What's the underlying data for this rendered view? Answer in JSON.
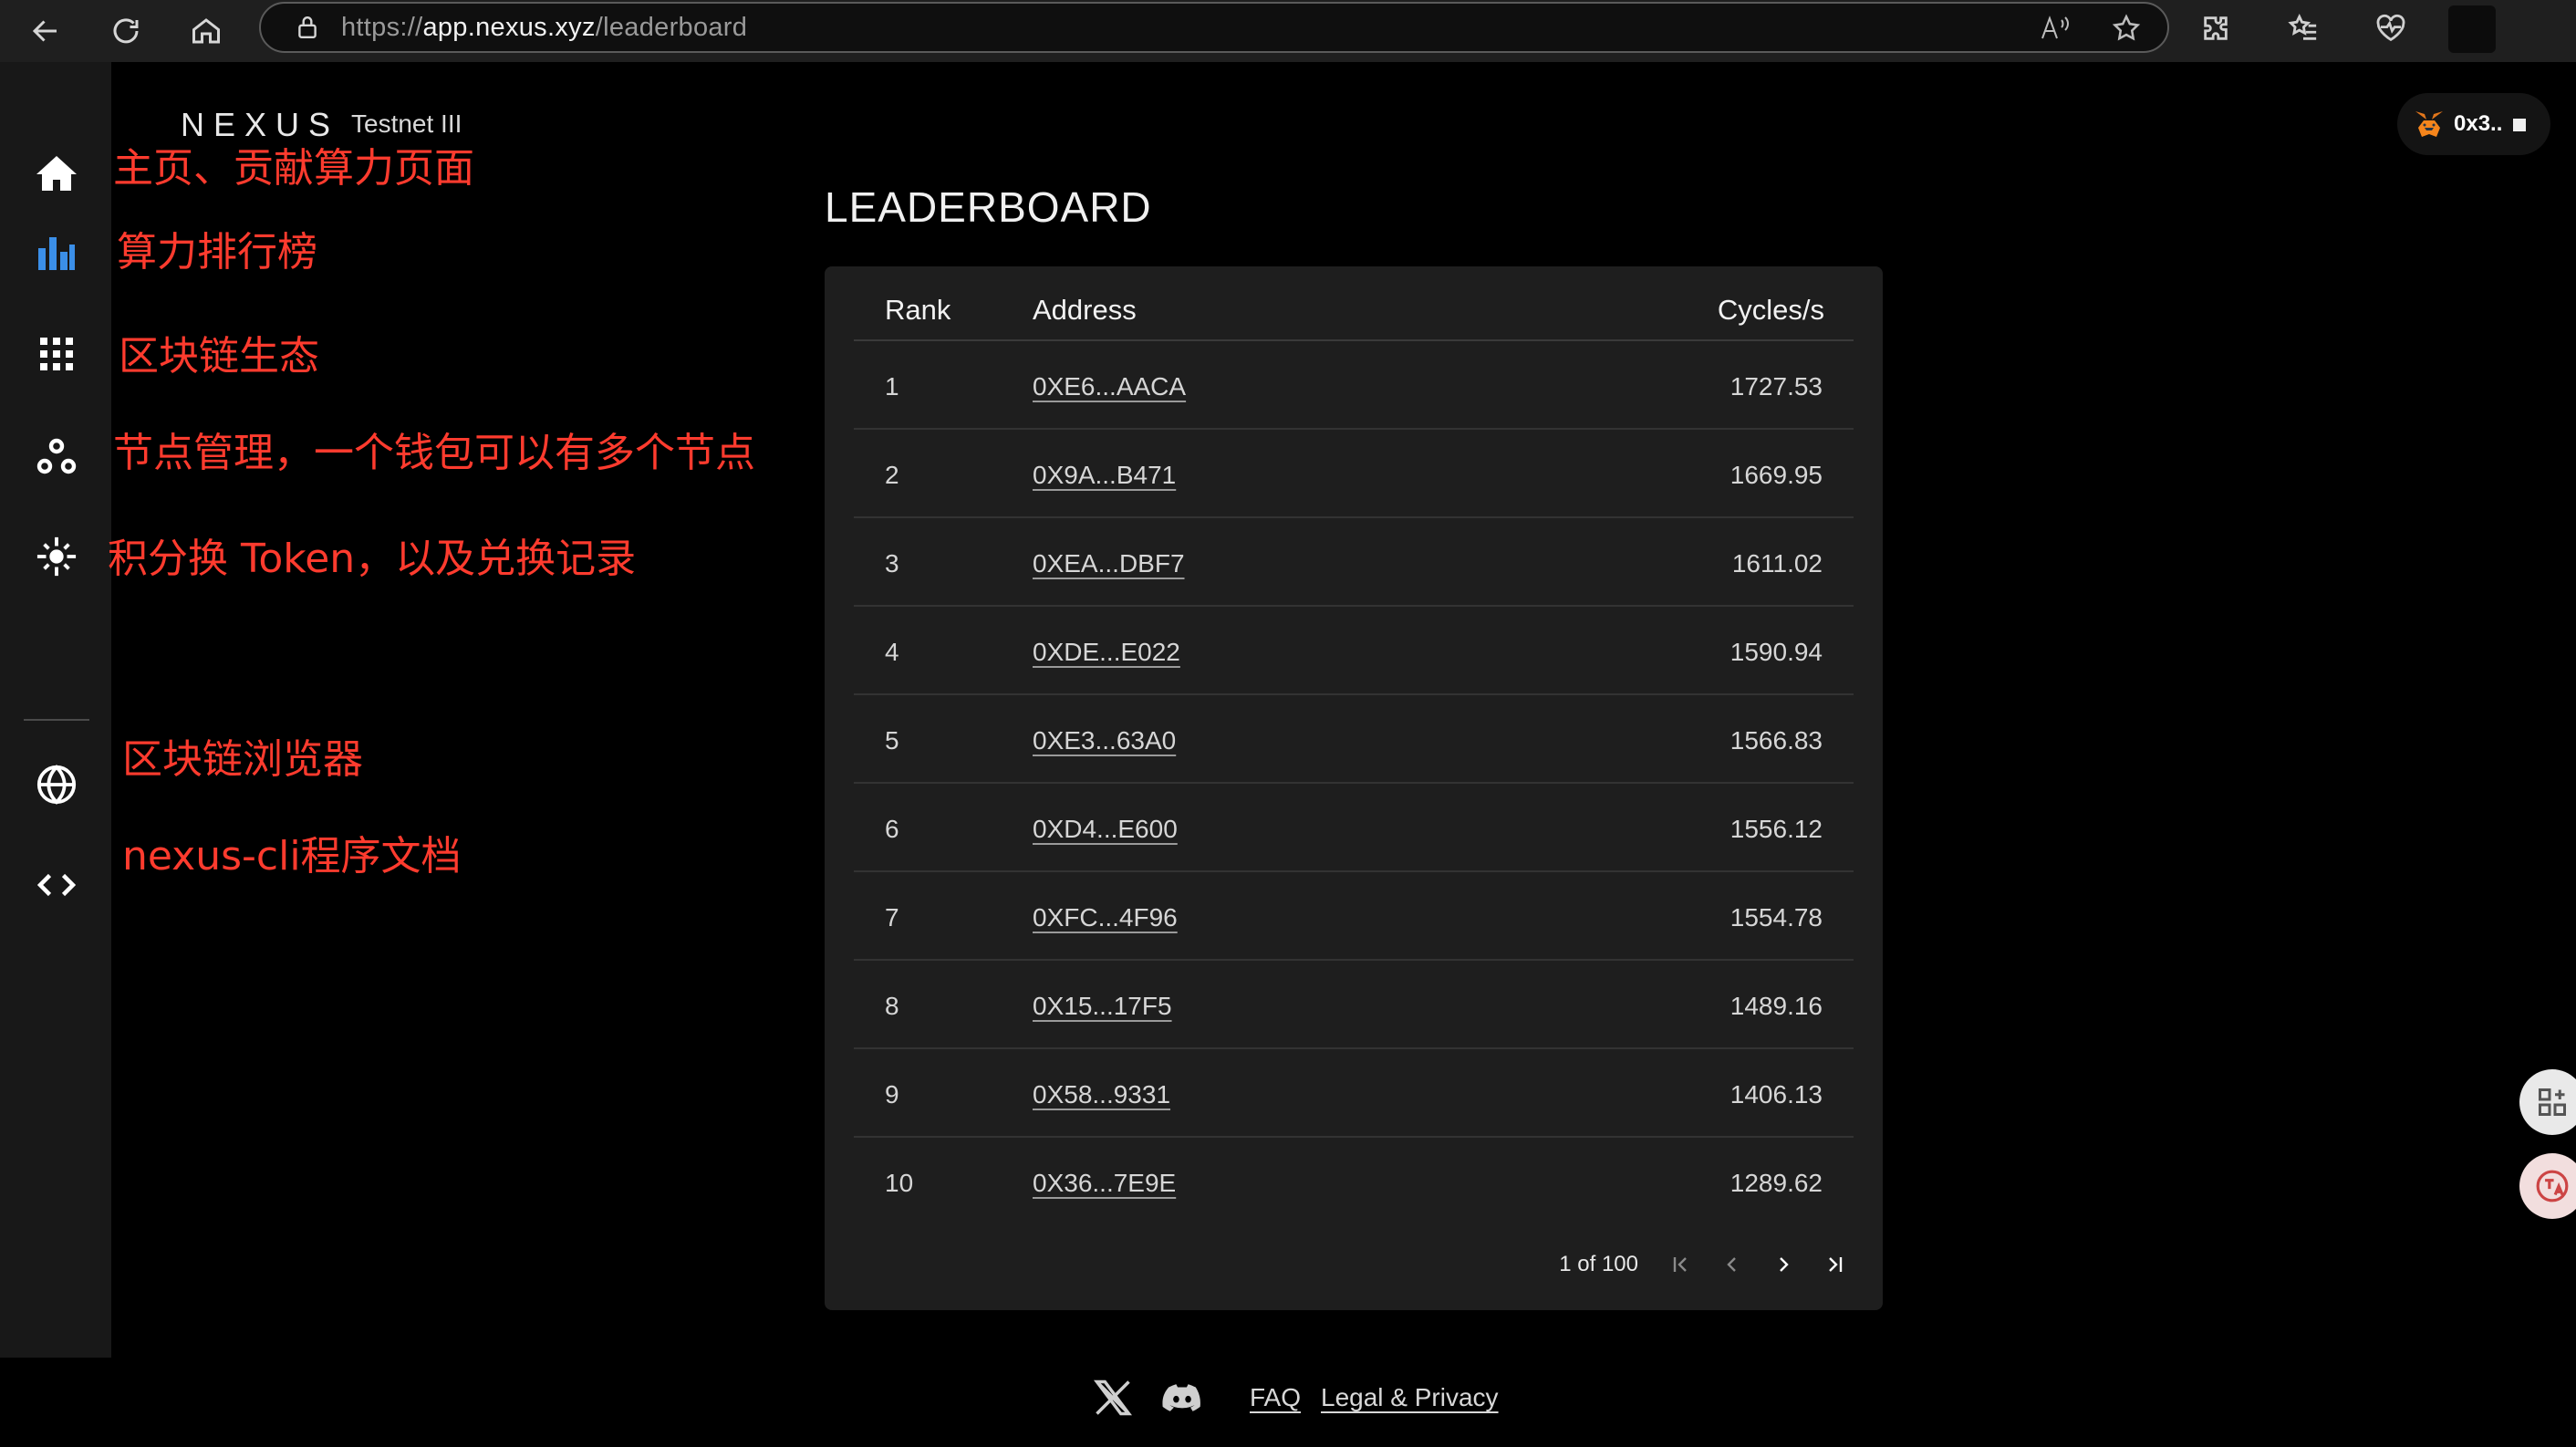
{
  "browser": {
    "url_prefix": "https://",
    "url_domain": "app.nexus.xyz",
    "url_path": "/leaderboard"
  },
  "brand": {
    "name": "NEXUS",
    "subtitle": "Testnet III"
  },
  "wallet": {
    "address_short": "0x3.."
  },
  "annotations": {
    "home": "主页、贡献算力页面",
    "leaderboard": "算力排行榜",
    "ecosystem": "区块链生态",
    "nodes": "节点管理，一个钱包可以有多个节点",
    "rewards": "积分换 Token，以及兑换记录",
    "explorer": "区块链浏览器",
    "docs": "nexus-cli程序文档"
  },
  "leaderboard": {
    "title": "LEADERBOARD",
    "columns": {
      "rank": "Rank",
      "address": "Address",
      "cycles": "Cycles/s"
    },
    "rows": [
      {
        "rank": "1",
        "address": "0XE6...AACA",
        "cycles": "1727.53"
      },
      {
        "rank": "2",
        "address": "0X9A...B471",
        "cycles": "1669.95"
      },
      {
        "rank": "3",
        "address": "0XEA...DBF7",
        "cycles": "1611.02"
      },
      {
        "rank": "4",
        "address": "0XDE...E022",
        "cycles": "1590.94"
      },
      {
        "rank": "5",
        "address": "0XE3...63A0",
        "cycles": "1566.83"
      },
      {
        "rank": "6",
        "address": "0XD4...E600",
        "cycles": "1556.12"
      },
      {
        "rank": "7",
        "address": "0XFC...4F96",
        "cycles": "1554.78"
      },
      {
        "rank": "8",
        "address": "0X15...17F5",
        "cycles": "1489.16"
      },
      {
        "rank": "9",
        "address": "0X58...9331",
        "cycles": "1406.13"
      },
      {
        "rank": "10",
        "address": "0X36...7E9E",
        "cycles": "1289.62"
      }
    ],
    "pagination": {
      "text": "1 of 100"
    }
  },
  "footer": {
    "faq": "FAQ",
    "legal": "Legal & Privacy"
  }
}
